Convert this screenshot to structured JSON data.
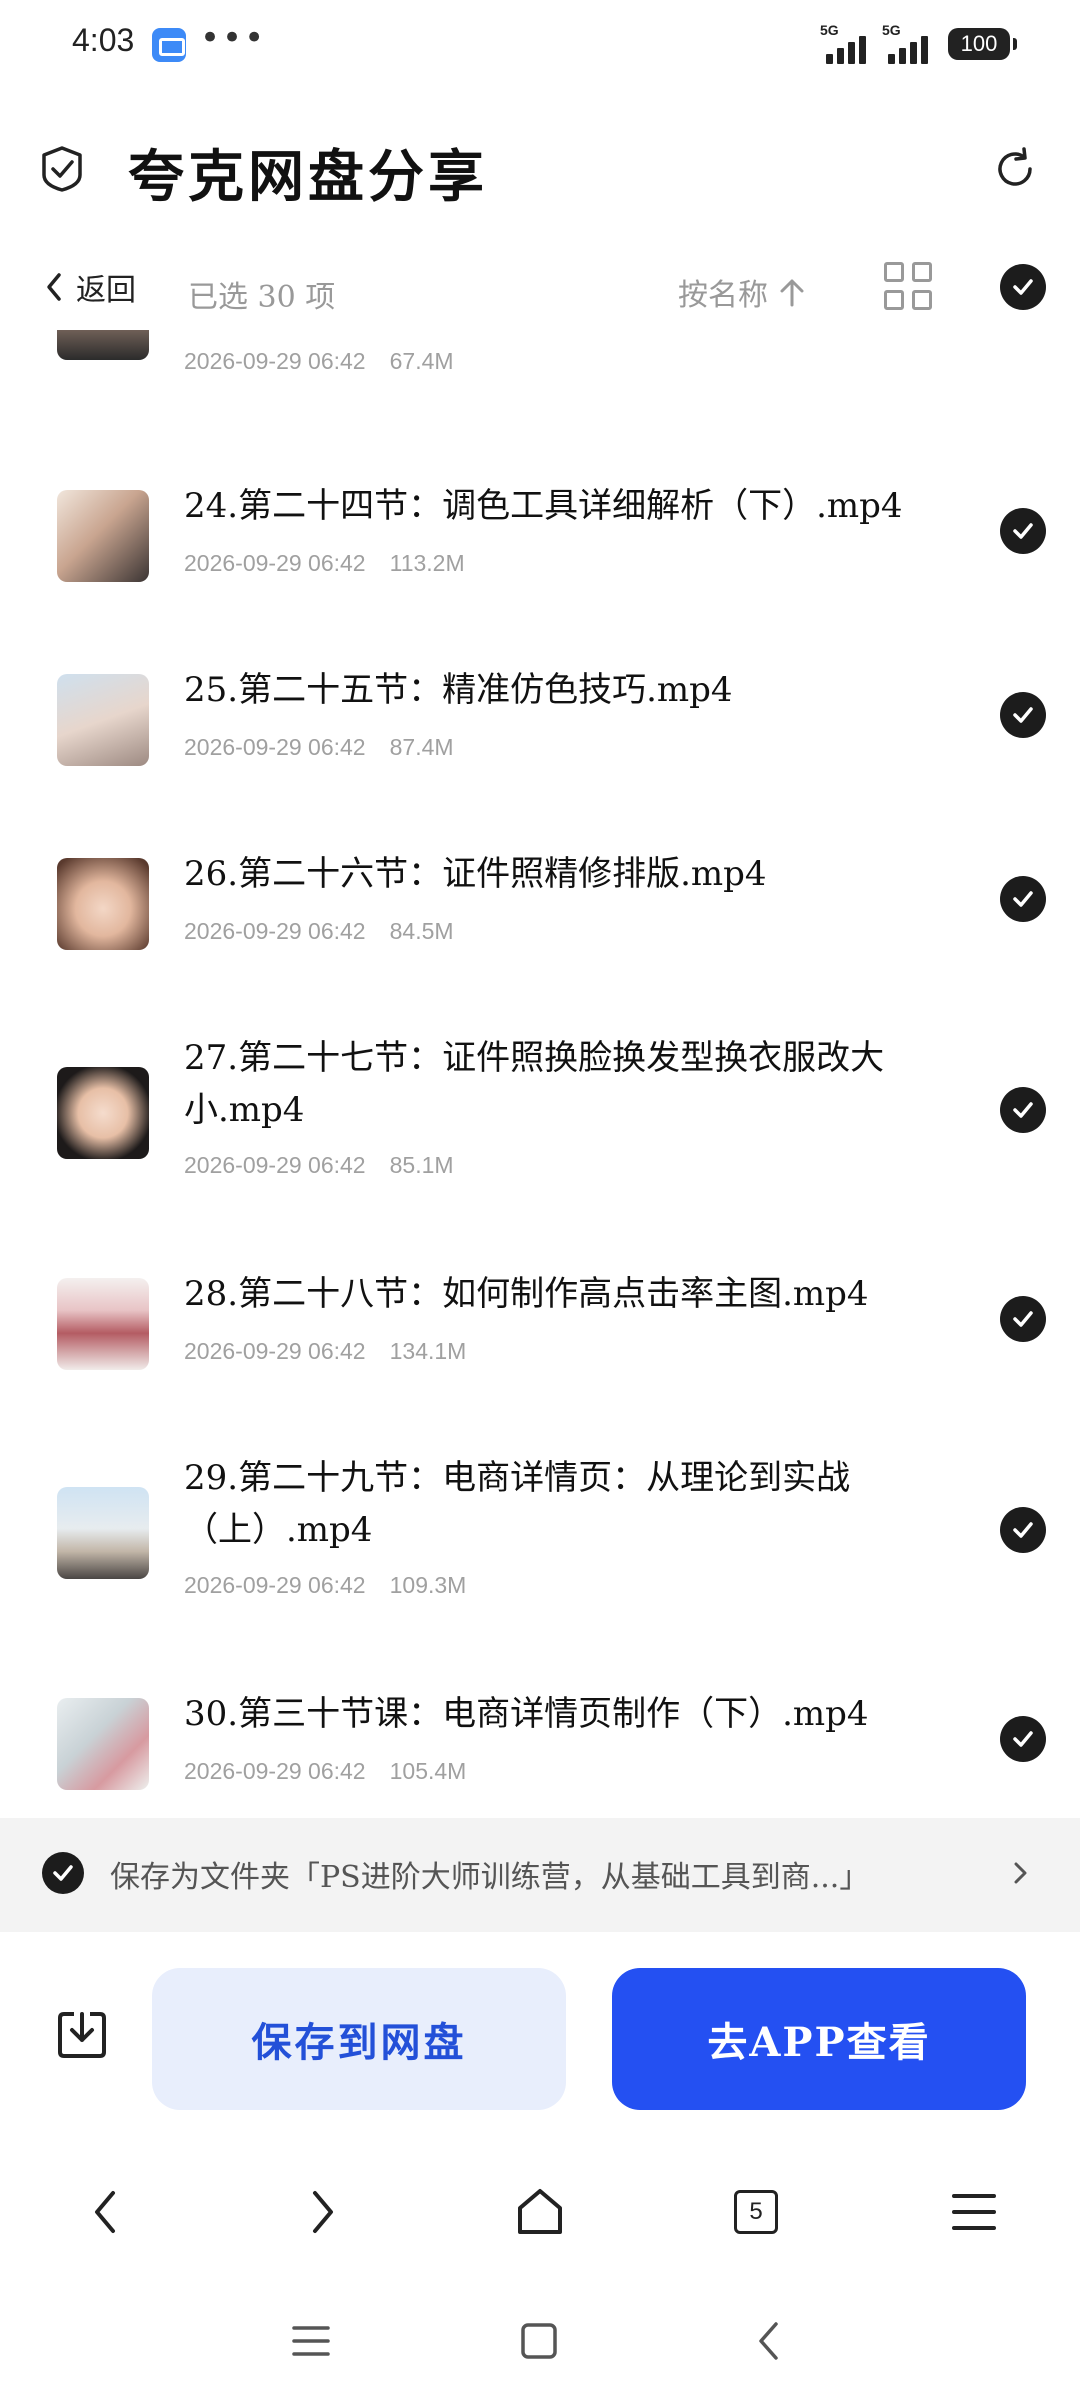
{
  "status_bar": {
    "time": "4:03",
    "dots": "•••",
    "net1": "5G",
    "net2": "5G",
    "battery": "100"
  },
  "header": {
    "title": "夸克网盘分享"
  },
  "toolbar": {
    "back_label": "返回",
    "selected_count": "已选 30 项",
    "sort_label": "按名称"
  },
  "files": [
    {
      "name": "",
      "date": "2026-09-29 06:42",
      "size": "67.4M"
    },
    {
      "name": "24.第二十四节：调色工具详细解析（下）.mp4",
      "date": "2026-09-29 06:42",
      "size": "113.2M"
    },
    {
      "name": "25.第二十五节：精准仿色技巧.mp4",
      "date": "2026-09-29 06:42",
      "size": "87.4M"
    },
    {
      "name": "26.第二十六节：证件照精修排版.mp4",
      "date": "2026-09-29 06:42",
      "size": "84.5M"
    },
    {
      "name": "27.第二十七节：证件照换脸换发型换衣服改大小.mp4",
      "date": "2026-09-29 06:42",
      "size": "85.1M"
    },
    {
      "name": "28.第二十八节：如何制作高点击率主图.mp4",
      "date": "2026-09-29 06:42",
      "size": "134.1M"
    },
    {
      "name": "29.第二十九节：电商详情页：从理论到实战（上）.mp4",
      "date": "2026-09-29 06:42",
      "size": "109.3M"
    },
    {
      "name": "30.第三十节课：电商详情页制作（下）.mp4",
      "date": "2026-09-29 06:42",
      "size": "105.4M"
    }
  ],
  "save_folder": {
    "text": "保存为文件夹「PS进阶大师训练营，从基础工具到商...」"
  },
  "actions": {
    "save_label": "保存到网盘",
    "app_label": "去APP查看"
  },
  "browser_nav": {
    "tabs_count": "5"
  },
  "colors": {
    "primary_blue": "#2450f2",
    "light_blue": "#e8eefc",
    "check_dark": "#1c1c1c"
  },
  "icons": [
    "shield-check-icon",
    "refresh-icon",
    "chevron-left-icon",
    "sort-up-icon",
    "grid-icon",
    "check-circle-icon",
    "download-icon",
    "back-icon",
    "forward-icon",
    "home-icon",
    "tabs-icon",
    "menu-icon",
    "recents-icon",
    "square-icon"
  ]
}
